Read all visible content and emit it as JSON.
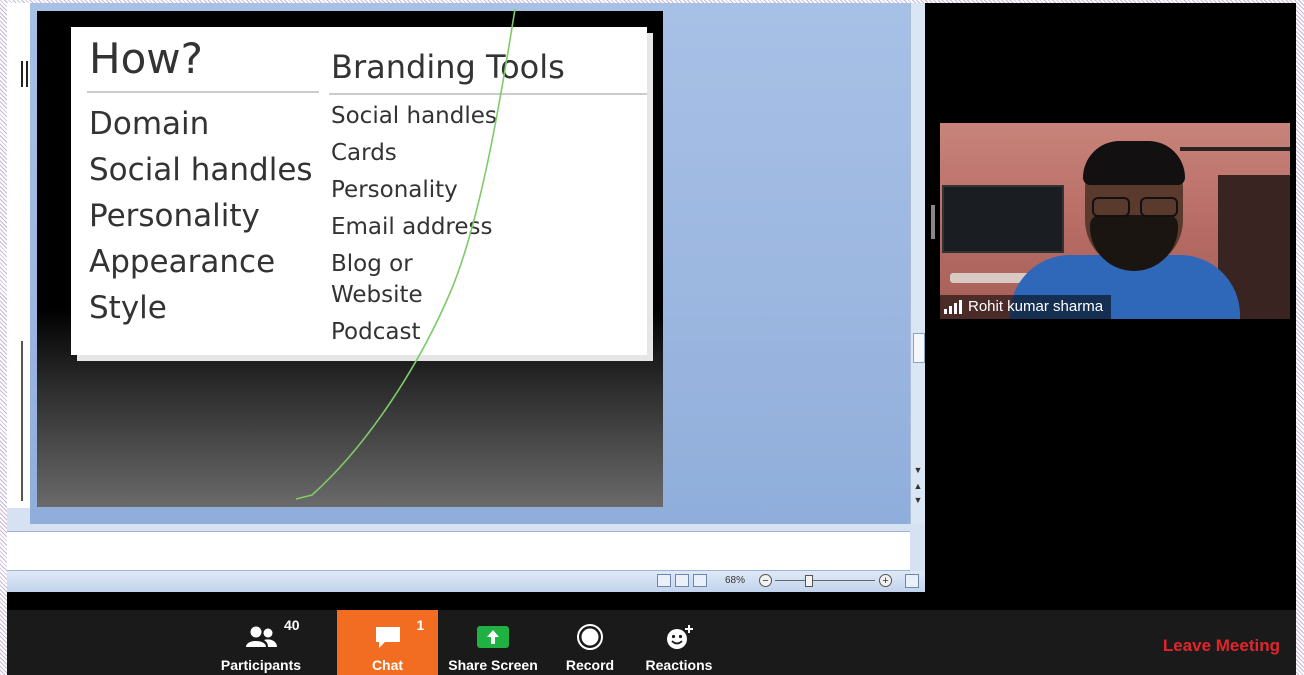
{
  "slide": {
    "left_heading": "How?",
    "left_items": [
      "Domain",
      "Social handles",
      "Personality",
      "Appearance",
      "Style"
    ],
    "right_heading": "Branding Tools",
    "right_items": [
      "Social handles",
      "Cards",
      "Personality",
      "Email address",
      "Blog or",
      "Website",
      "Podcast"
    ]
  },
  "powerpoint": {
    "zoom": "68%"
  },
  "video": {
    "participant_name": "Rohit kumar sharma"
  },
  "toolbar": {
    "participants_label": "Participants",
    "participants_count": "40",
    "chat_label": "Chat",
    "chat_count": "1",
    "share_label": "Share Screen",
    "record_label": "Record",
    "reactions_label": "Reactions",
    "leave_label": "Leave Meeting"
  },
  "colors": {
    "chat_accent": "#f26d21",
    "share_green": "#1fb141",
    "leave_red": "#e0262b",
    "ink_green": "#7ecb6a"
  }
}
